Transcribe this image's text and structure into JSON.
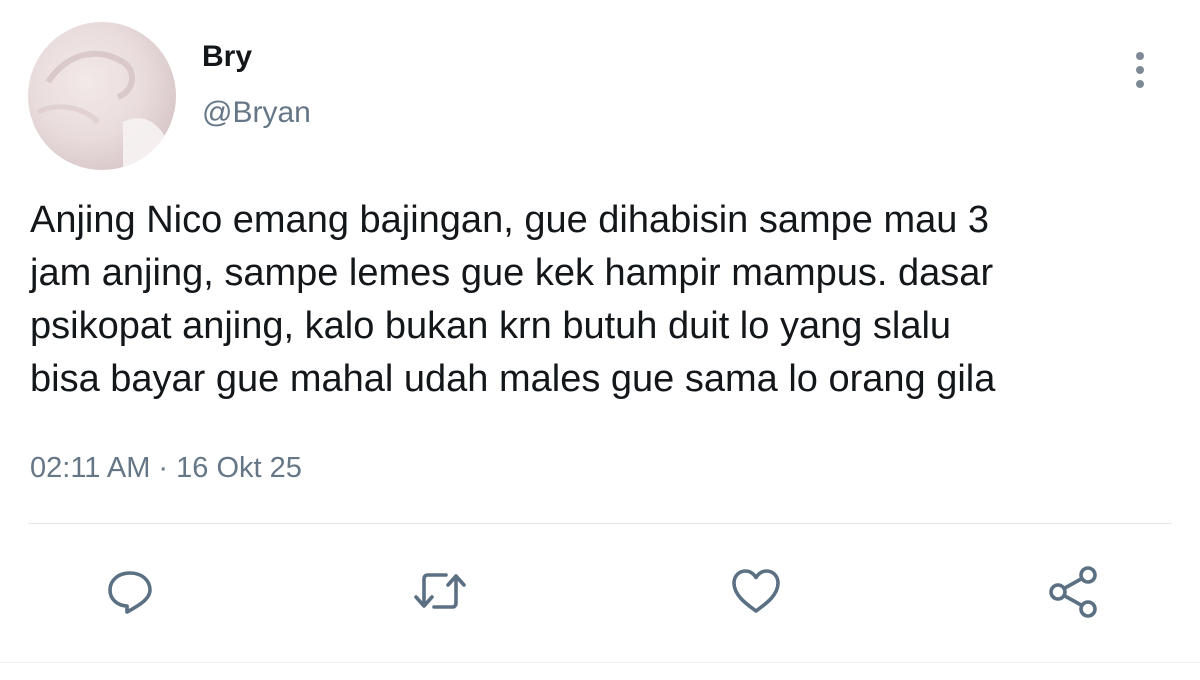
{
  "user": {
    "display_name": "Bry",
    "handle": "@Bryan"
  },
  "tweet": {
    "text": "Anjing Nico emang bajingan, gue dihabisin sampe mau 3\njam anjing, sampe lemes gue kek hampir mampus. dasar\npsikopat anjing, kalo bukan krn butuh duit lo yang slalu\nbisa bayar gue mahal udah males gue sama lo orang gila",
    "timestamp": "02:11 AM · 16 Okt 25"
  },
  "actions": {
    "reply_icon": "reply-icon",
    "retweet_icon": "retweet-icon",
    "like_icon": "heart-icon",
    "share_icon": "share-icon"
  },
  "colors": {
    "text": "#14171a",
    "muted": "#657786",
    "icon": "#5b7083",
    "divider": "#e1e8ed"
  }
}
